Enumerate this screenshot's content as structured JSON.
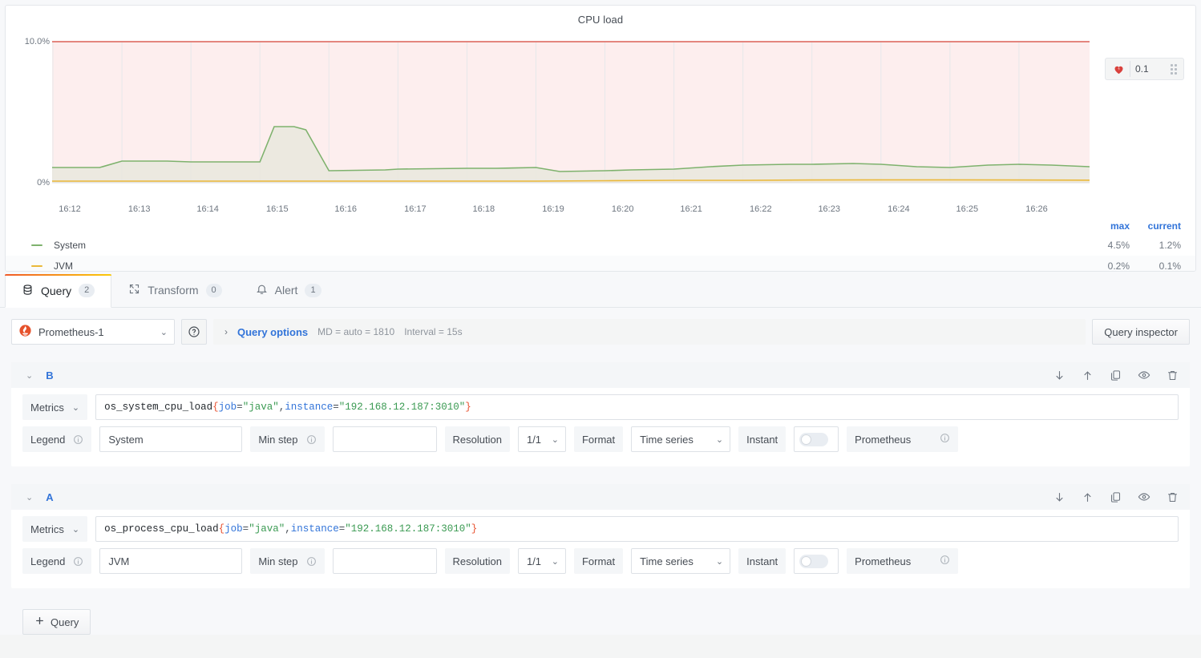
{
  "panel": {
    "title": "CPU load",
    "y_axis": {
      "ticks": [
        "10.0%",
        "0%"
      ]
    },
    "x_axis": {
      "ticks": [
        "16:12",
        "16:13",
        "16:14",
        "16:15",
        "16:16",
        "16:17",
        "16:18",
        "16:19",
        "16:20",
        "16:21",
        "16:22",
        "16:23",
        "16:24",
        "16:25",
        "16:26"
      ]
    },
    "threshold": {
      "value": "0.1",
      "icon": "broken-heart-icon",
      "grip": "drag-handle-icon",
      "color": "#e0756d"
    },
    "legend": {
      "columns": [
        "max",
        "current"
      ],
      "series": [
        {
          "name": "System",
          "color": "#7eb26d",
          "max": "4.5%",
          "current": "1.2%"
        },
        {
          "name": "JVM",
          "color": "#eab839",
          "max": "0.2%",
          "current": "0.1%"
        }
      ]
    }
  },
  "chart_data": {
    "type": "area",
    "title": "CPU load",
    "xlabel": "",
    "ylabel": "",
    "ylim": [
      0,
      10
    ],
    "yunit": "%",
    "grid": true,
    "legend_position": "bottom",
    "threshold": {
      "value": 0.1,
      "region_color": "#fdecec",
      "line_color": "#e0756d",
      "op": "gt"
    },
    "x": [
      "16:12",
      "16:13",
      "16:14",
      "16:15",
      "16:16",
      "16:17",
      "16:18",
      "16:19",
      "16:20",
      "16:21",
      "16:22",
      "16:23",
      "16:24",
      "16:25",
      "16:26"
    ],
    "series": [
      {
        "name": "System",
        "color": "#7eb26d",
        "max": 4.5,
        "current": 1.2,
        "values": [
          1.1,
          1.1,
          1.6,
          1.5,
          1.5,
          4.5,
          4.5,
          1.0,
          1.1,
          1.2,
          1.2,
          1.2,
          1.1,
          1.0,
          1.2,
          1.2,
          1.1,
          1.2,
          1.3,
          1.4,
          1.4,
          1.3,
          1.4,
          1.2
        ]
      },
      {
        "name": "JVM",
        "color": "#eab839",
        "max": 0.2,
        "current": 0.1,
        "values": [
          0.1,
          0.1,
          0.1,
          0.1,
          0.1,
          0.15,
          0.15,
          0.1,
          0.1,
          0.1,
          0.1,
          0.1,
          0.1,
          0.1,
          0.12,
          0.15,
          0.15,
          0.15,
          0.18,
          0.2,
          0.18,
          0.15,
          0.15,
          0.12
        ]
      }
    ]
  },
  "tabs": [
    {
      "label": "Query",
      "count": "2",
      "icon": "database-icon",
      "active": true
    },
    {
      "label": "Transform",
      "count": "0",
      "icon": "transform-icon",
      "active": false
    },
    {
      "label": "Alert",
      "count": "1",
      "icon": "bell-icon",
      "active": false
    }
  ],
  "toolbar": {
    "datasource": "Prometheus-1",
    "datasource_icon": "prometheus-icon",
    "help_icon": "help-circle-icon",
    "query_options_label": "Query options",
    "query_options_meta": [
      "MD = auto = 1810",
      "Interval = 15s"
    ],
    "query_inspector_label": "Query inspector"
  },
  "queries": [
    {
      "ref": "B",
      "metrics_label": "Metrics",
      "expr": {
        "metric": "os_system_cpu_load",
        "open_brace": "{",
        "labels": [
          {
            "key": "job",
            "op": "=",
            "value": "\"java\"",
            "sep": ","
          },
          {
            "key": "instance",
            "op": "=",
            "value": "\"192.168.12.187:3010\"",
            "sep": ""
          }
        ],
        "close_brace": "}"
      },
      "legend_label": "Legend",
      "legend_value": "System",
      "min_step_label": "Min step",
      "min_step_value": "",
      "resolution_label": "Resolution",
      "resolution_value": "1/1",
      "format_label": "Format",
      "format_value": "Time series",
      "instant_label": "Instant",
      "instant_on": false,
      "prometheus_label": "Prometheus"
    },
    {
      "ref": "A",
      "metrics_label": "Metrics",
      "expr": {
        "metric": "os_process_cpu_load",
        "open_brace": "{",
        "labels": [
          {
            "key": "job",
            "op": "=",
            "value": "\"java\"",
            "sep": ","
          },
          {
            "key": "instance",
            "op": "=",
            "value": "\"192.168.12.187:3010\"",
            "sep": ""
          }
        ],
        "close_brace": "}"
      },
      "legend_label": "Legend",
      "legend_value": "JVM",
      "min_step_label": "Min step",
      "min_step_value": "",
      "resolution_label": "Resolution",
      "resolution_value": "1/1",
      "format_label": "Format",
      "format_value": "Time series",
      "instant_label": "Instant",
      "instant_on": false,
      "prometheus_label": "Prometheus"
    }
  ],
  "row_actions": [
    "move-down-icon",
    "move-up-icon",
    "duplicate-icon",
    "toggle-visibility-icon",
    "remove-icon"
  ],
  "add_query_label": "Query"
}
